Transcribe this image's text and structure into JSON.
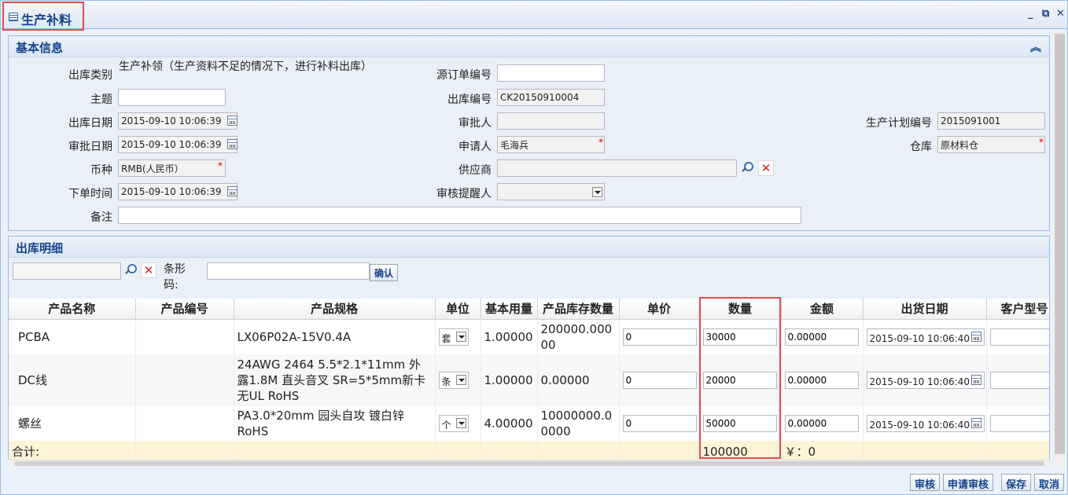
{
  "window": {
    "title": "生产补料"
  },
  "basic": {
    "header": "基本信息",
    "fields": {
      "out_type": {
        "label": "出库类别",
        "value": "生产补领（生产资料不足的情况下，进行补料出库）"
      },
      "source_order": {
        "label": "源订单编号",
        "value": ""
      },
      "subject": {
        "label": "主题",
        "value": ""
      },
      "out_no": {
        "label": "出库编号",
        "value": "CK20150910004"
      },
      "out_date": {
        "label": "出库日期",
        "value": "2015-09-10 10:06:39"
      },
      "approver": {
        "label": "审批人",
        "value": ""
      },
      "plan_no": {
        "label": "生产计划编号",
        "value": "2015091001"
      },
      "approve_date": {
        "label": "审批日期",
        "value": "2015-09-10 10:06:39"
      },
      "applicant": {
        "label": "申请人",
        "value": "毛海兵"
      },
      "warehouse": {
        "label": "仓库",
        "value": "原材料仓"
      },
      "currency": {
        "label": "币种",
        "value": "RMB(人民币）"
      },
      "supplier": {
        "label": "供应商",
        "value": ""
      },
      "order_time": {
        "label": "下单时间",
        "value": "2015-09-10 10:06:39"
      },
      "reminder": {
        "label": "审核提醒人",
        "value": ""
      },
      "remark": {
        "label": "备注",
        "value": ""
      }
    }
  },
  "detail": {
    "header": "出库明细",
    "barcode_label": "条形码:",
    "confirm_label": "确认",
    "columns": [
      "产品名称",
      "产品编号",
      "产品规格",
      "单位",
      "基本用量",
      "产品库存数量",
      "单价",
      "数量",
      "金额",
      "出货日期",
      "客户型号"
    ],
    "rows": [
      {
        "name": "PCBA",
        "code": "",
        "spec": "LX06P02A-15V0.4A",
        "unit": "套",
        "base": "1.00000",
        "stock": "200000.00000",
        "price": "0",
        "qty": "30000",
        "amount": "0.00000",
        "date": "2015-09-10 10:06:40",
        "model": ""
      },
      {
        "name": "DC线",
        "code": "",
        "spec": "24AWG 2464 5.5*2.1*11mm 外露1.8M 直头音叉 SR=5*5mm新卡无UL RoHS",
        "unit": "条",
        "base": "1.00000",
        "stock": "0.00000",
        "price": "0",
        "qty": "20000",
        "amount": "0.00000",
        "date": "2015-09-10 10:06:40",
        "model": ""
      },
      {
        "name": "螺丝",
        "code": "",
        "spec": "PA3.0*20mm 园头自攻 镀白锌 RoHS",
        "unit": "个",
        "base": "4.00000",
        "stock": "10000000.00000",
        "price": "0",
        "qty": "50000",
        "amount": "0.00000",
        "date": "2015-09-10 10:06:40",
        "model": ""
      }
    ],
    "summary": {
      "label": "合计:",
      "qty_total": "100000",
      "amount_total": "￥：0"
    }
  },
  "buttons": {
    "review": "审核",
    "request_review": "申请审核",
    "save": "保存",
    "cancel": "取消"
  },
  "colors": {
    "accent": "#15428b",
    "highlight_box": "#e34b4b",
    "summary_row": "#fdf4d7"
  }
}
